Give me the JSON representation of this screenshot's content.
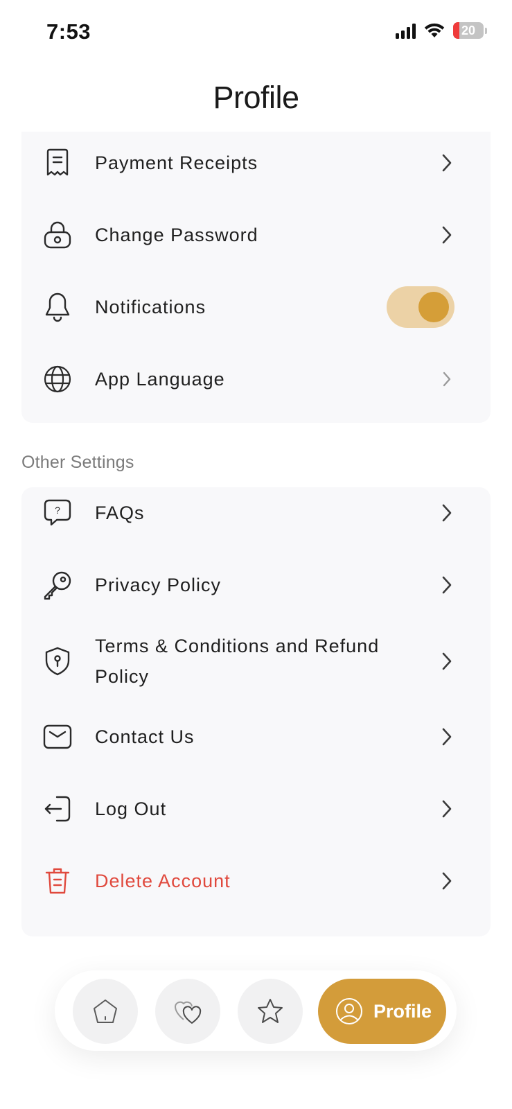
{
  "status_bar": {
    "time": "7:53",
    "battery_percent": "20",
    "icons": [
      "cellular-signal-icon",
      "wifi-icon",
      "battery-icon"
    ]
  },
  "header": {
    "title": "Profile"
  },
  "account_settings": {
    "items": [
      {
        "label": "Payment Receipts",
        "icon": "receipt-icon"
      },
      {
        "label": "Change Password",
        "icon": "lock-icon"
      },
      {
        "label": "Notifications",
        "icon": "bell-icon",
        "toggle_on": true
      },
      {
        "label": "App Language",
        "icon": "globe-icon"
      }
    ]
  },
  "other_settings": {
    "title": "Other Settings",
    "items": [
      {
        "label": "FAQs",
        "icon": "question-chat-icon"
      },
      {
        "label": "Privacy Policy",
        "icon": "key-icon"
      },
      {
        "label": "Terms & Conditions and Refund Policy",
        "icon": "shield-icon"
      },
      {
        "label": "Contact Us",
        "icon": "mail-icon"
      },
      {
        "label": "Log Out",
        "icon": "logout-icon"
      },
      {
        "label": "Delete Account",
        "icon": "trash-icon"
      }
    ]
  },
  "bottom_nav": {
    "items": [
      {
        "icon": "home-icon"
      },
      {
        "icon": "hearts-icon"
      },
      {
        "icon": "star-icon"
      },
      {
        "icon": "user-icon",
        "label": "Profile",
        "active": true
      }
    ]
  },
  "colors": {
    "accent": "#d39c3a",
    "toggle_track": "#ecd2a6",
    "danger": "#e0493d",
    "card_bg": "#f8f8fa"
  }
}
